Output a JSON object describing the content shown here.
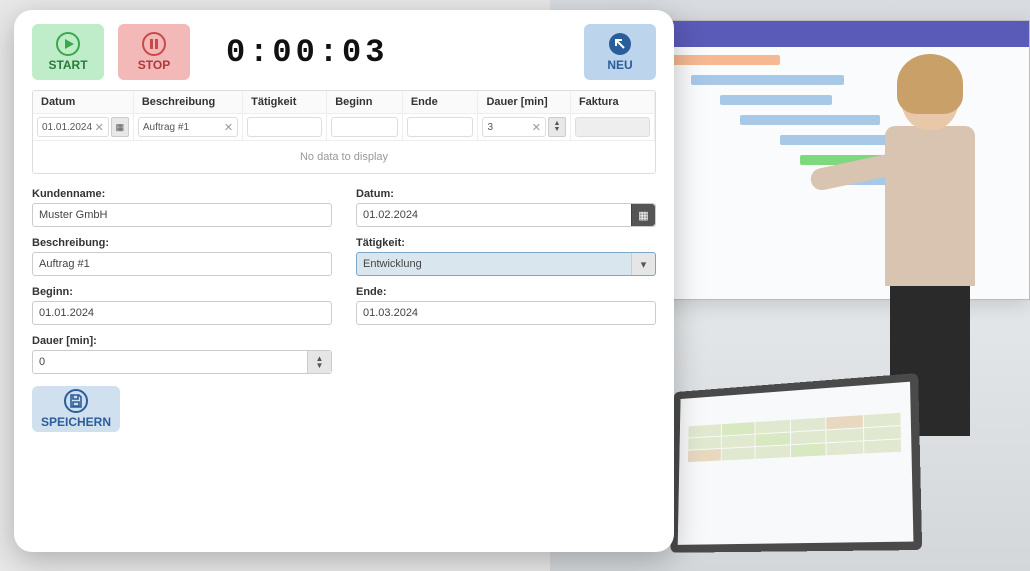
{
  "buttons": {
    "start": "START",
    "stop": "STOP",
    "neu": "NEU",
    "speichern": "SPEICHERN"
  },
  "timer": "0:00:03",
  "grid": {
    "headers": {
      "datum": "Datum",
      "beschreibung": "Beschreibung",
      "taetigkeit": "Tätigkeit",
      "beginn": "Beginn",
      "ende": "Ende",
      "dauer": "Dauer [min]",
      "faktura": "Faktura"
    },
    "filters": {
      "datum": "01.01.2024",
      "beschreibung": "Auftrag #1",
      "taetigkeit": "",
      "beginn": "",
      "ende": "",
      "dauer": "3",
      "faktura": ""
    },
    "empty": "No data to display"
  },
  "form": {
    "kundenname": {
      "label": "Kundenname:",
      "value": "Muster GmbH"
    },
    "datum": {
      "label": "Datum:",
      "value": "01.02.2024"
    },
    "beschreibung": {
      "label": "Beschreibung:",
      "value": "Auftrag #1"
    },
    "taetigkeit": {
      "label": "Tätigkeit:",
      "value": "Entwicklung"
    },
    "beginn": {
      "label": "Beginn:",
      "value": "01.01.2024"
    },
    "ende": {
      "label": "Ende:",
      "value": "01.03.2024"
    },
    "dauer": {
      "label": "Dauer [min]:",
      "value": "0"
    }
  }
}
